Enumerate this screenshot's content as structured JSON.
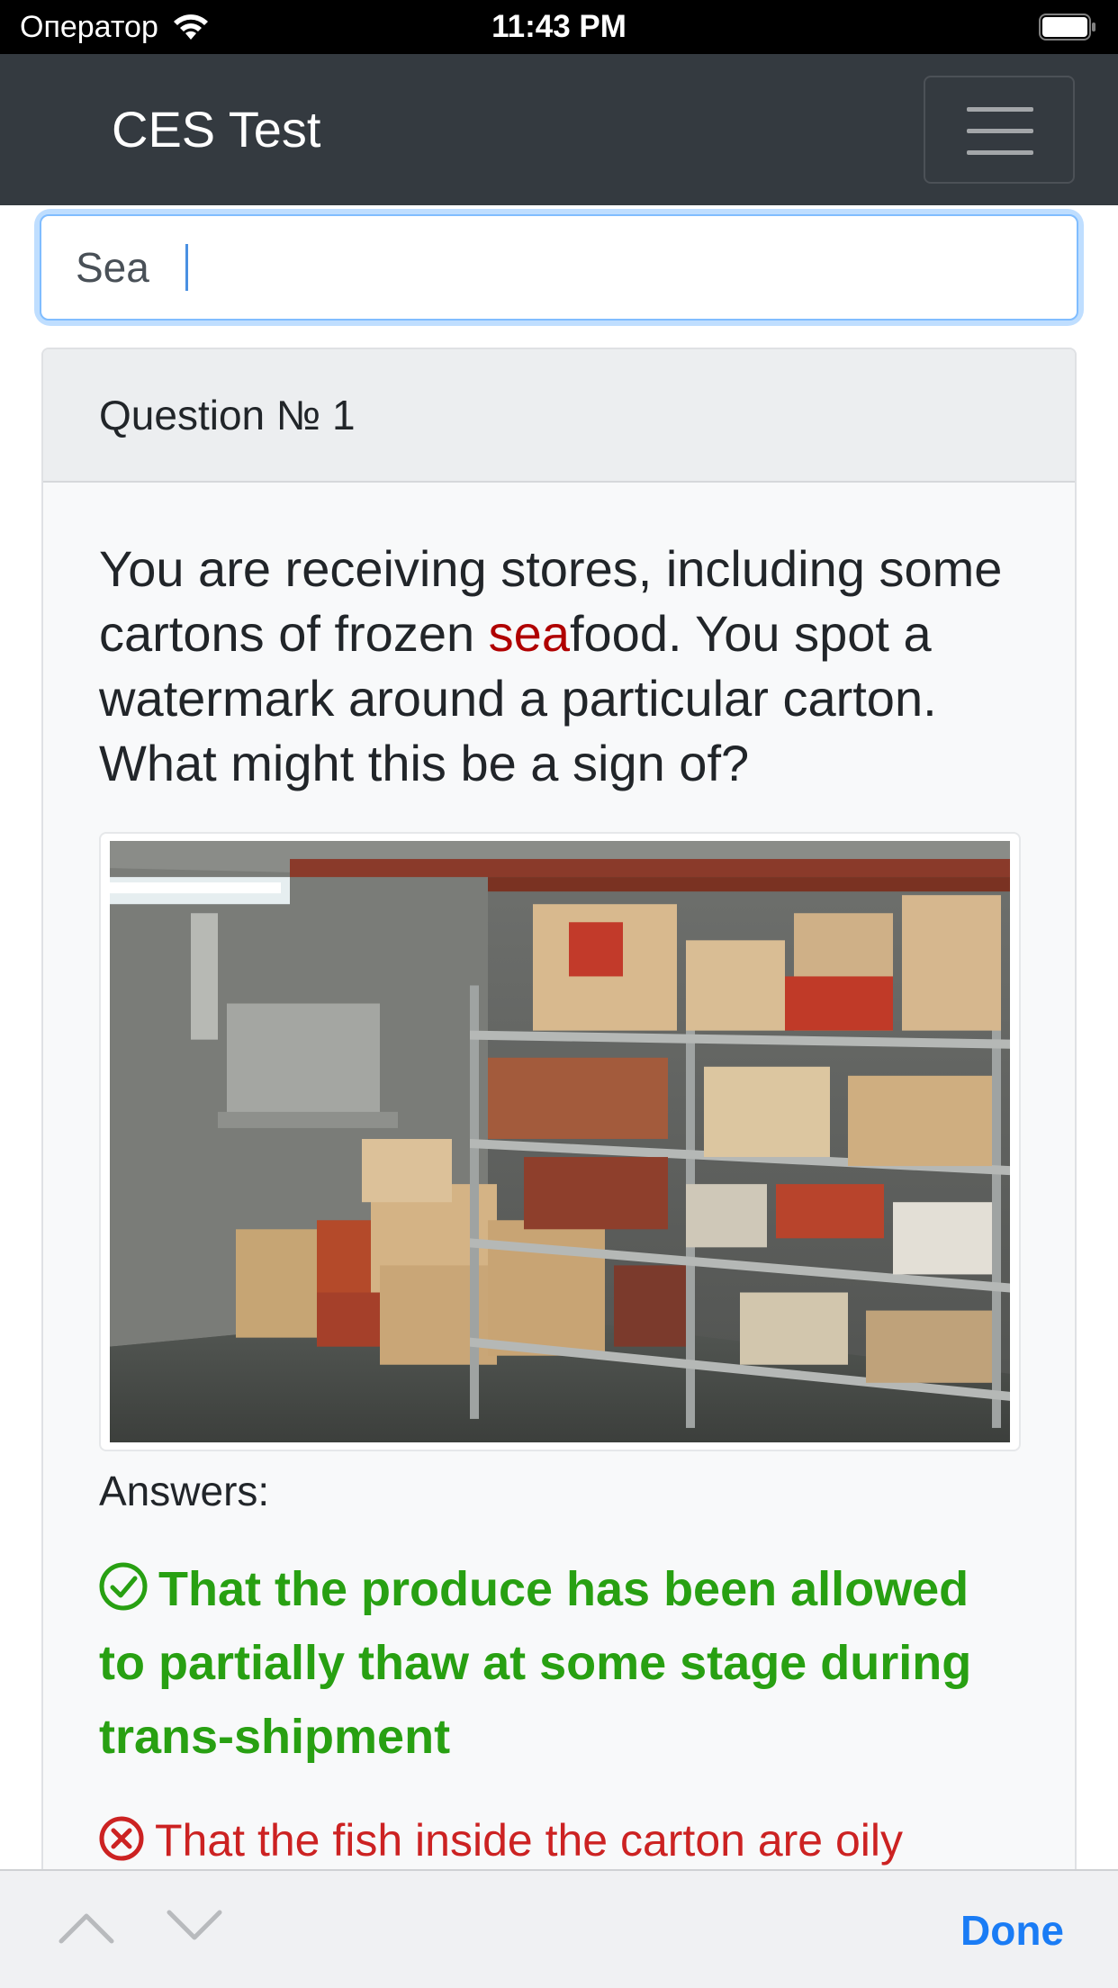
{
  "status_bar": {
    "carrier": "Оператор",
    "time": "11:43 PM",
    "icons": [
      "wifi-icon",
      "battery-icon"
    ]
  },
  "navbar": {
    "brand": "CES Test",
    "toggler_icon": "hamburger-menu-icon"
  },
  "search": {
    "value": "Sea"
  },
  "question_card": {
    "header": "Question № 1",
    "question_before": "You are receiving stores, including some cartons of frozen ",
    "question_highlight": "sea",
    "question_after": "food. You spot a watermark around a particular carton. What might this be a sign of?",
    "answers_label": "Answers:",
    "answers": [
      {
        "text": "That the produce has been allowed to partially thaw at some stage during trans-shipment",
        "correct": true,
        "icon": "check-circle-icon"
      },
      {
        "text": "That the fish inside the carton are oily",
        "correct": false,
        "icon": "x-circle-icon"
      }
    ]
  },
  "accessory_bar": {
    "prev_icon": "chevron-up-icon",
    "next_icon": "chevron-down-icon",
    "done_label": "Done"
  },
  "colors": {
    "navbar_bg": "#343a40",
    "highlight": "#b00000",
    "correct": "#28a012",
    "wrong": "#cc2222",
    "done": "#1a7cf5"
  }
}
